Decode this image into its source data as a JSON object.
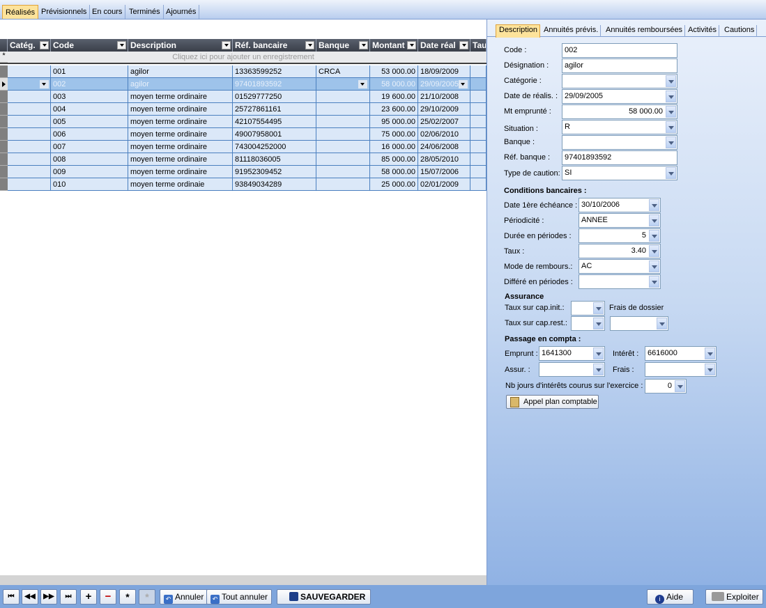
{
  "top_tabs": [
    "Réalisés",
    "Prévisionnels",
    "En cours",
    "Terminés",
    "Ajournés"
  ],
  "grid": {
    "columns": [
      "Catég.",
      "Code",
      "Description",
      "Réf. bancaire",
      "Banque",
      "Montant",
      "Date réal",
      "Tau"
    ],
    "add_row_text": "Cliquez ici pour ajouter un enregistrement",
    "rows": [
      {
        "categ": "",
        "code": "001",
        "description": "agilor",
        "ref": "13363599252",
        "banque": "CRCA",
        "montant": "53 000.00",
        "date": "18/09/2009"
      },
      {
        "categ": "",
        "code": "002",
        "description": "agilor",
        "ref": "97401893592",
        "banque": "",
        "montant": "58 000.00",
        "date": "29/09/2005"
      },
      {
        "categ": "",
        "code": "003",
        "description": "moyen terme ordinaire",
        "ref": "01529777250",
        "banque": "",
        "montant": "19 600.00",
        "date": "21/10/2008"
      },
      {
        "categ": "",
        "code": "004",
        "description": "moyen terme ordinaire",
        "ref": "25727861161",
        "banque": "",
        "montant": "23 600.00",
        "date": "29/10/2009"
      },
      {
        "categ": "",
        "code": "005",
        "description": "moyen terme ordinaire",
        "ref": "42107554495",
        "banque": "",
        "montant": "95 000.00",
        "date": "25/02/2007"
      },
      {
        "categ": "",
        "code": "006",
        "description": "moyen terme ordinaire",
        "ref": "49007958001",
        "banque": "",
        "montant": "75 000.00",
        "date": "02/06/2010"
      },
      {
        "categ": "",
        "code": "007",
        "description": "moyen terme ordinaire",
        "ref": "743004252000",
        "banque": "",
        "montant": "16 000.00",
        "date": "24/06/2008"
      },
      {
        "categ": "",
        "code": "008",
        "description": "moyen terme ordinaire",
        "ref": "81118036005",
        "banque": "",
        "montant": "85 000.00",
        "date": "28/05/2010"
      },
      {
        "categ": "",
        "code": "009",
        "description": "moyen terme ordinaire",
        "ref": "91952309452",
        "banque": "",
        "montant": "58 000.00",
        "date": "15/07/2006"
      },
      {
        "categ": "",
        "code": "010",
        "description": "moyen terme ordinaie",
        "ref": "93849034289",
        "banque": "",
        "montant": "25 000.00",
        "date": "02/01/2009"
      }
    ]
  },
  "right_tabs": [
    "Description",
    "Annuités prévis.",
    "Annuités remboursées",
    "Activités",
    "Cautions"
  ],
  "form": {
    "code_label": "Code :",
    "code": "002",
    "designation_label": "Désignation :",
    "designation": "agilor",
    "categorie_label": "Catégorie :",
    "categorie": "",
    "date_label": "Date de réalis. :",
    "date": "29/09/2005",
    "mt_label": "Mt emprunté :",
    "mt": "58 000.00",
    "situation_label": "Situation :",
    "situation": "R",
    "banque_label": "Banque :",
    "banque": "",
    "refb_label": "Réf. banque :",
    "refb": "97401893592",
    "caution_label": "Type de caution:",
    "caution": "SI",
    "cond_title": "Conditions bancaires :",
    "ech_label": "Date 1ère échéance :",
    "ech": "30/10/2006",
    "period_label": "Périodicité :",
    "period": "ANNEE",
    "duree_label": "Durée en périodes :",
    "duree": "5",
    "taux_label": "Taux :",
    "taux": "3.40",
    "mode_label": "Mode de rembours.:",
    "mode": "AC",
    "differe_label": "Différé en périodes :",
    "differe": "",
    "assur_title": "Assurance",
    "tci_label": "Taux sur cap.init.:",
    "tci": "",
    "frais_dossier_label": "Frais de dossier",
    "tcr_label": "Taux sur cap.rest.:",
    "tcr": "",
    "frais_dossier": "",
    "passage_title": "Passage en compta :",
    "emprunt_label": "Emprunt :",
    "emprunt": "1641300",
    "interet_label": "Intérêt :",
    "interet": "6616000",
    "assur_label": "Assur. :",
    "assur": "",
    "frais_label": "Frais :",
    "frais": "",
    "nbjours_label": "Nb jours d'intérêts courus sur l'exercice :",
    "nbjours": "0",
    "appel_label": "Appel plan comptable"
  },
  "toolbar": {
    "annuler": "Annuler",
    "tout_annuler": "Tout annuler",
    "sauvegarder": "SAUVEGARDER",
    "aide": "Aide",
    "exploiter": "Exploiter"
  }
}
